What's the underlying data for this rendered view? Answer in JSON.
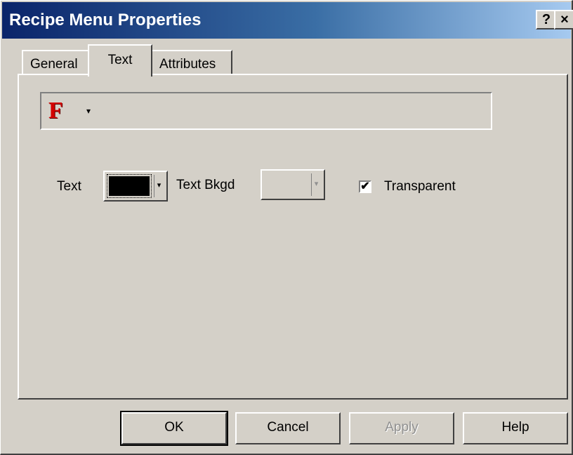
{
  "window": {
    "title": "Recipe Menu Properties",
    "help_button": "?",
    "close_button": "×"
  },
  "tabs": [
    {
      "label": "General",
      "selected": false
    },
    {
      "label": "Text",
      "selected": true
    },
    {
      "label": "Attributes",
      "selected": false
    }
  ],
  "font_toolbar": {
    "font_icon": "F",
    "dropdown_icon": "▾"
  },
  "colors": {
    "text_label": "Text",
    "text_color": "#000000",
    "text_bkgd_label": "Text Bkgd",
    "text_bkgd_enabled": false,
    "dropdown_arrow": "▾",
    "transparent_label": "Transparent",
    "transparent_checked": true,
    "check_mark": "✔"
  },
  "buttons": {
    "ok": "OK",
    "cancel": "Cancel",
    "apply": "Apply",
    "help": "Help"
  },
  "theme": {
    "title_gradient_start": "#0a246a",
    "title_gradient_end": "#a6caf0",
    "face": "#d4d0c8",
    "font_icon_color": "#d40000"
  }
}
